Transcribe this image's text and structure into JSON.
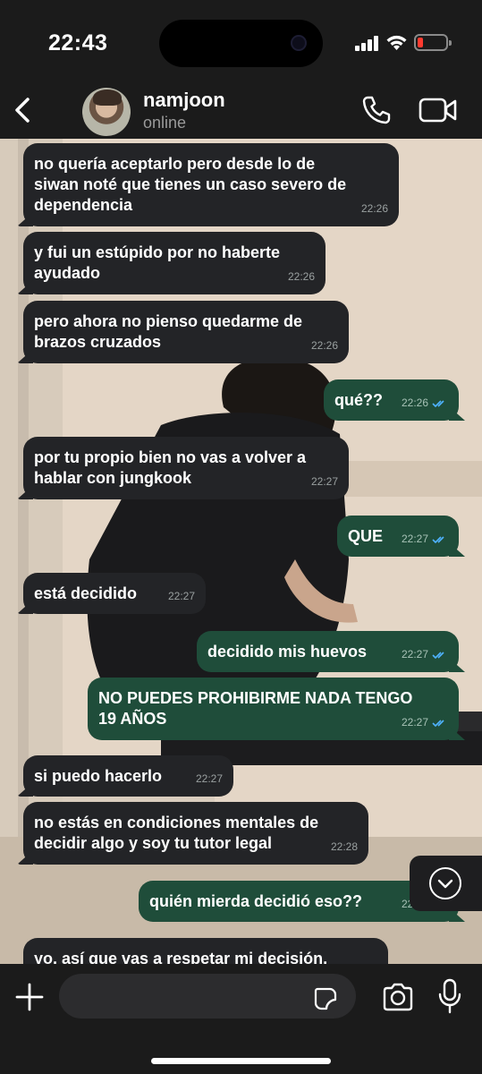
{
  "status_bar": {
    "time": "22:43"
  },
  "header": {
    "contact_name": "namjoon",
    "contact_status": "online"
  },
  "colors": {
    "incoming_bubble": "#232427",
    "outgoing_bubble": "#1f4d3a",
    "read_ticks": "#4fb3ff",
    "battery_low": "#ff3b30"
  },
  "messages": [
    {
      "direction": "in",
      "text": "no quería aceptarlo pero desde lo de\nsiwan noté que tienes un caso severo de\ndependencia",
      "time": "22:26"
    },
    {
      "direction": "in",
      "text": "y fui un estúpido por no haberte\nayudado",
      "time": "22:26"
    },
    {
      "direction": "in",
      "text": "pero ahora no pienso quedarme de\nbrazos cruzados",
      "time": "22:26"
    },
    {
      "direction": "out",
      "text": "qué??",
      "time": "22:26",
      "read": true
    },
    {
      "direction": "in",
      "text": "por tu propio bien no vas a volver a\nhablar con jungkook",
      "time": "22:27"
    },
    {
      "direction": "out",
      "text": "QUE",
      "time": "22:27",
      "read": true
    },
    {
      "direction": "in",
      "text": "está decidido",
      "time": "22:27"
    },
    {
      "direction": "out",
      "text": "decidido mis huevos",
      "time": "22:27",
      "read": true
    },
    {
      "direction": "out",
      "text": "NO PUEDES PROHIBIRME NADA TENGO\n19 AÑOS",
      "time": "22:27",
      "read": true
    },
    {
      "direction": "in",
      "text": "si puedo hacerlo",
      "time": "22:27"
    },
    {
      "direction": "in",
      "text": "no estás en condiciones mentales de\ndecidir algo y soy tu tutor legal",
      "time": "22:28"
    },
    {
      "direction": "out",
      "text": "quién mierda decidió eso??",
      "time": "22:28",
      "read": true
    },
    {
      "direction": "in",
      "text": "yo, así que vas a respetar mi decisión,",
      "time": ""
    }
  ],
  "icons": {
    "back": "chevron-left-icon",
    "call": "phone-icon",
    "video": "video-camera-icon",
    "scroll": "chevron-down-icon",
    "plus": "plus-icon",
    "sticker": "sticker-icon",
    "camera": "camera-icon",
    "mic": "microphone-icon"
  },
  "input": {
    "value": "",
    "placeholder": ""
  }
}
